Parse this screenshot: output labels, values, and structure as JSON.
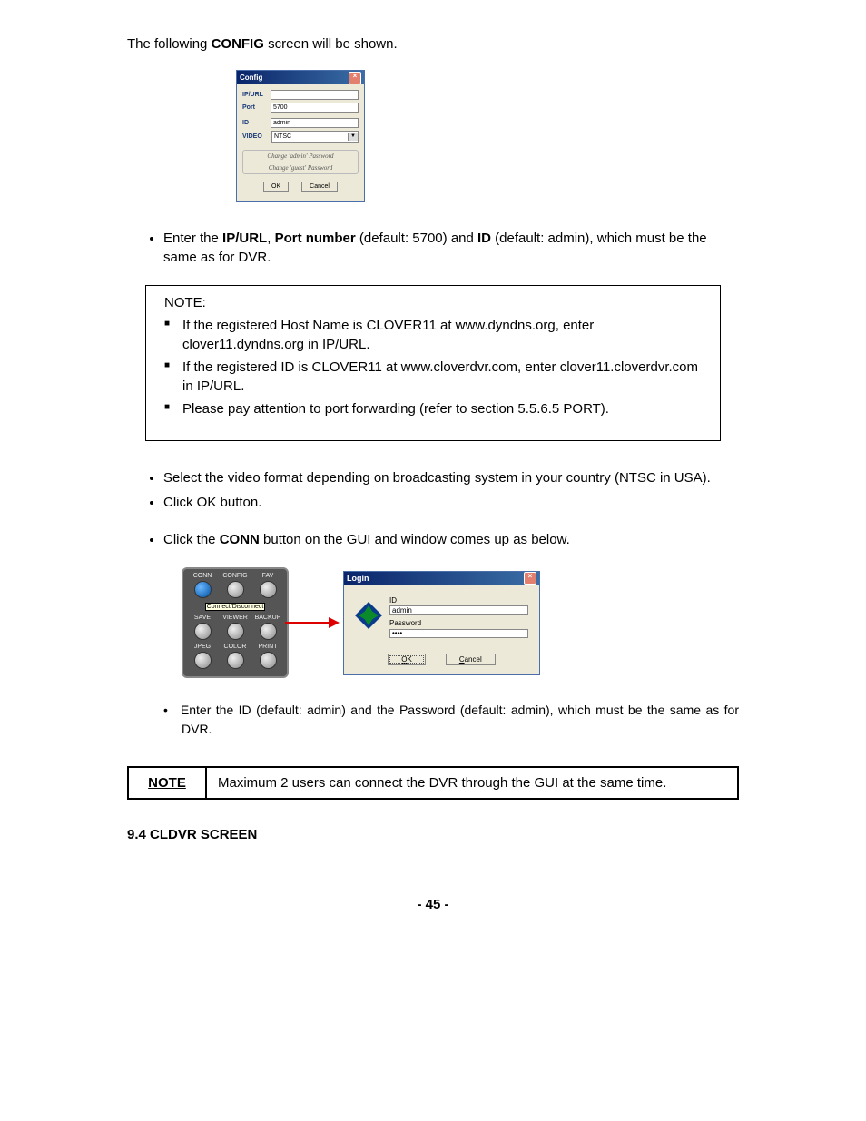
{
  "intro": {
    "prefix": "The following ",
    "bold": "CONFIG",
    "suffix": " screen will be shown."
  },
  "config_dialog": {
    "title": "Config",
    "fields": {
      "ipurl_label": "IP/URL",
      "ipurl_value": "",
      "port_label": "Port",
      "port_value": "5700",
      "id_label": "ID",
      "id_value": "admin",
      "video_label": "VIDEO",
      "video_value": "NTSC"
    },
    "pw1": "Change 'admin' Password",
    "pw2": "Change 'guest' Password",
    "ok": "OK",
    "cancel": "Cancel"
  },
  "bullet1": {
    "p1": "Enter the ",
    "b1": "IP/URL",
    "p2": ", ",
    "b2": "Port number",
    "p3": " (default: 5700) and ",
    "b3": "ID",
    "p4": " (default: admin), which must be the same as for DVR."
  },
  "note1": {
    "title": "NOTE:",
    "items": [
      "If the registered Host Name is CLOVER11 at www.dyndns.org, enter clover11.dyndns.org in IP/URL.",
      "If the registered ID is CLOVER11 at www.cloverdvr.com, enter clover11.cloverdvr.com in IP/URL.",
      "Please pay attention to port forwarding (refer to section 5.5.6.5 PORT)."
    ]
  },
  "bullets2": [
    "Select the video format depending on broadcasting system in your country (NTSC in USA).",
    "Click OK button."
  ],
  "bullet3": {
    "p1": "Click the ",
    "b1": "CONN",
    "p2": " button on the GUI and window comes up as below."
  },
  "gui": {
    "labels": [
      "CONN",
      "CONFIG",
      "FAV",
      "SAVE",
      "VIEWER",
      "BACKUP",
      "JPEG",
      "COLOR",
      "PRINT"
    ],
    "tooltip": "Connect/Disconnect"
  },
  "login_dialog": {
    "title": "Login",
    "id_label": "ID",
    "id_value": "admin",
    "pw_label": "Password",
    "pw_value": "••••",
    "ok": "OK",
    "cancel": "Cancel"
  },
  "bullet4": "Enter the ID (default: admin) and the Password (default: admin), which must be the same as for DVR.",
  "note_table": {
    "label": "NOTE",
    "text": "Maximum 2 users can connect the DVR through the GUI at the same time."
  },
  "section": "9.4 CLDVR SCREEN",
  "page_num": "- 45 -"
}
